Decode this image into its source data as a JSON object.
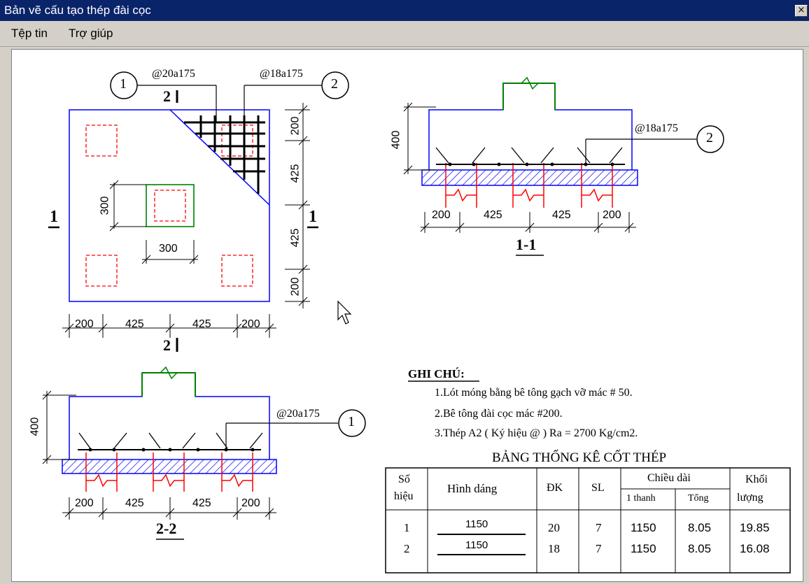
{
  "window": {
    "title": "Bản vẽ cấu tạo thép đài cọc",
    "close_symbol": "×"
  },
  "menu": {
    "items": [
      "Tệp tin",
      "Trợ giúp"
    ]
  },
  "plan": {
    "callout_left_num": "1",
    "callout_left_label": "@20a175",
    "callout_right_num": "2",
    "callout_right_label": "@18a175",
    "section_top": "2",
    "section_bottom": "2",
    "section_left": "1",
    "section_right": "1",
    "bottom_dims": [
      "200",
      "425",
      "425",
      "200"
    ],
    "right_dims": [
      "200",
      "425",
      "425",
      "200"
    ],
    "column_dim_vertical": "300",
    "column_dim_horizontal": "300"
  },
  "section_1_1": {
    "height_dim": "400",
    "rebar_label": "@18a175",
    "rebar_num": "2",
    "bottom_dims": [
      "200",
      "425",
      "425",
      "200"
    ],
    "caption": "1-1"
  },
  "section_2_2": {
    "height_dim": "400",
    "rebar_label": "@20a175",
    "rebar_num": "1",
    "bottom_dims": [
      "200",
      "425",
      "425",
      "200"
    ],
    "caption": "2-2"
  },
  "notes": {
    "heading": "GHI CHÚ:",
    "lines": [
      "1.Lót móng bằng bê tông gạch vỡ mác # 50.",
      "2.Bê tông đài cọc mác #200.",
      "3.Thép A2 ( Ký hiệu @ ) Ra = 2700 Kg/cm2."
    ]
  },
  "table": {
    "title": "BẢNG THỐNG KÊ CỐT THÉP",
    "headers": {
      "so_hieu_1": "Số",
      "so_hieu_2": "hiệu",
      "hinh_dang": "Hình dáng",
      "dk": "ĐK",
      "sl": "SL",
      "chieu_dai": "Chiều dài",
      "mot_thanh": "1 thanh",
      "tong": "Tổng",
      "khoi_1": "Khối",
      "khoi_2": "lượng"
    },
    "rows": [
      {
        "so_hieu": "1",
        "hinh_dang": "1150",
        "dk": "20",
        "sl": "7",
        "mot_thanh": "1150",
        "tong": "8.05",
        "khoi_luong": "19.85"
      },
      {
        "so_hieu": "2",
        "hinh_dang": "1150",
        "dk": "18",
        "sl": "7",
        "mot_thanh": "1150",
        "tong": "8.05",
        "khoi_luong": "16.08"
      }
    ]
  },
  "colors": {
    "titlebar": "#0a246a",
    "outline_blue": "#0000ff",
    "pile_red": "#ff0000",
    "column_green": "#008000",
    "rebar_black": "#000000"
  }
}
